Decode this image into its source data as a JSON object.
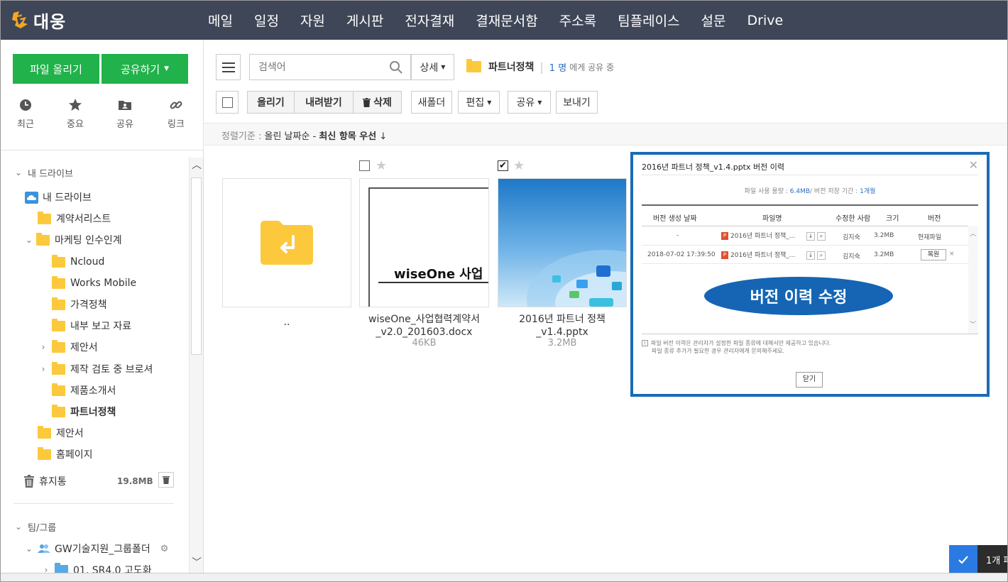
{
  "brand": {
    "name": "대웅"
  },
  "nav": [
    "메일",
    "일정",
    "자원",
    "게시판",
    "전자결재",
    "결재문서함",
    "주소록",
    "팀플레이스",
    "설문",
    "Drive"
  ],
  "sidebar": {
    "upload_label": "파일 올리기",
    "share_label": "공유하기",
    "quick": [
      {
        "icon": "clock-icon",
        "label": "최근"
      },
      {
        "icon": "star-icon",
        "label": "중요"
      },
      {
        "icon": "shared-folder-icon",
        "label": "공유"
      },
      {
        "icon": "link-icon",
        "label": "링크"
      }
    ],
    "my_drive_section": "내 드라이브",
    "my_drive_root": "내 드라이브",
    "tree": [
      "계약서리스트",
      "마케팅 인수인계",
      "Ncloud",
      "Works Mobile",
      "가격정책",
      "내부 보고 자료",
      "제안서",
      "제작 검토 중 브로셔",
      "제품소개서",
      "파트너정책",
      "제안서",
      "홈페이지"
    ],
    "trash_label": "휴지통",
    "trash_size": "19.8MB",
    "team_section": "팀/그룹",
    "team_folder": "GW기술지원_그룹폴더",
    "team_sub": "01. SR4.0 고도화"
  },
  "toolbar": {
    "search_placeholder": "검색어",
    "detail_label": "상세",
    "current_folder": "파트너정책",
    "share_count": "1 명",
    "share_suffix": "에게 공유 중",
    "upload": "올리기",
    "download": "내려받기",
    "delete": "삭제",
    "new_folder": "새폴더",
    "edit": "편집",
    "share": "공유",
    "send": "보내기"
  },
  "sort": {
    "prefix": "정렬기준 :",
    "by": "올린 날짜순 -",
    "order": "최신 항목 우선",
    "arrow": "↓"
  },
  "files": [
    {
      "name": "..",
      "size": ""
    },
    {
      "name": "wiseOne_사업협력계약서_v2.0_201603.docx",
      "size": "46KB",
      "preview_text": "wiseOne 사업"
    },
    {
      "name": "2016년 파트너 정책_v1.4.pptx",
      "size": "3.2MB",
      "checked": true
    }
  ],
  "dialog": {
    "title": "2016년 파트너 정책_v1.4.pptx 버전 이력",
    "usage_prefix": "파일 사용 용량 :",
    "usage_value": "6.4MB",
    "usage_mid": "/ 버전 저장 기간 :",
    "usage_period": "1개월",
    "headers": [
      "버전 생성 날짜",
      "파일명",
      "수정한 사람",
      "크기",
      "버전"
    ],
    "rows": [
      {
        "date": "-",
        "file": "2016년 파트너 정책_...",
        "editor": "김지숙",
        "size": "3.2MB",
        "version": "현재파일"
      },
      {
        "date": "2018-07-02 17:39:50",
        "file": "2016년 파트너 정책_...",
        "editor": "김지숙",
        "size": "3.2MB",
        "version": "복원"
      }
    ],
    "callout": "버전 이력 수정",
    "note_line1": "파일 버전 이력은 관리자가 설정한 파일 종류에 대해서만 제공하고 있습니다.",
    "note_line2": "파일 종류 추가가 필요한 경우 관리자에게 문의해주세요.",
    "close_label": "닫기"
  },
  "toast": {
    "text": "1개 파"
  }
}
